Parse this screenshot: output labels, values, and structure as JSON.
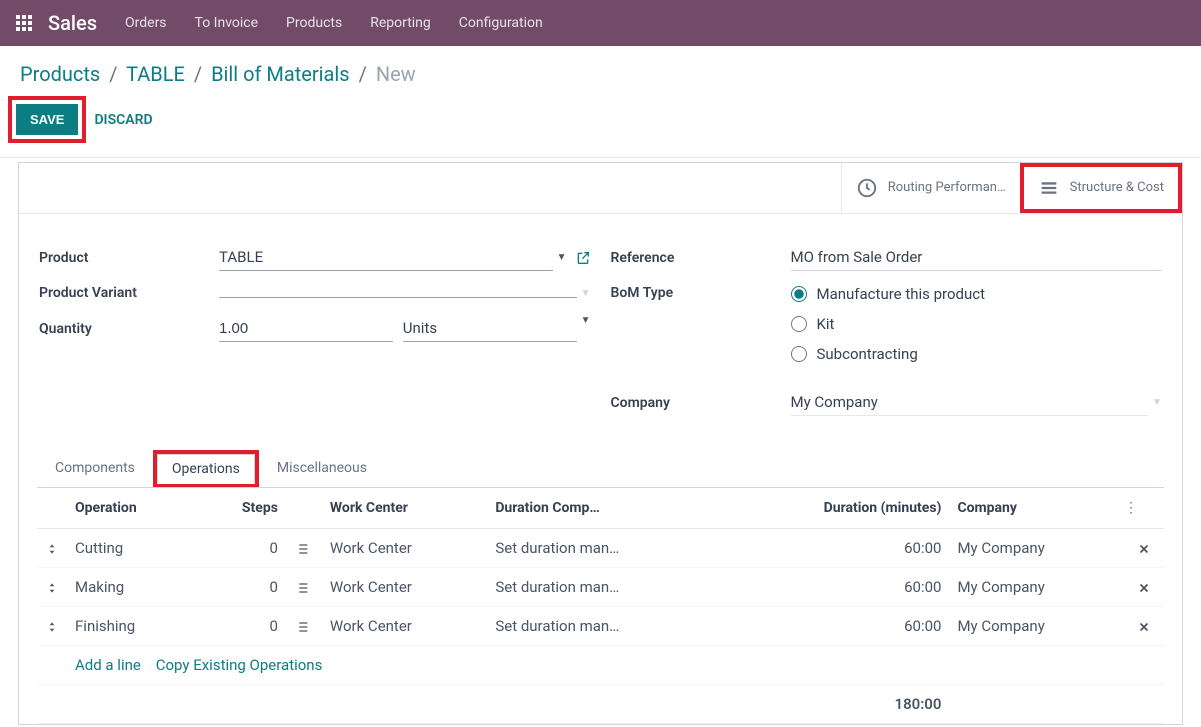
{
  "nav": {
    "brand": "Sales",
    "items": [
      "Orders",
      "To Invoice",
      "Products",
      "Reporting",
      "Configuration"
    ]
  },
  "breadcrumb": {
    "parts": [
      "Products",
      "TABLE",
      "Bill of Materials"
    ],
    "current": "New"
  },
  "actions": {
    "save": "SAVE",
    "discard": "DISCARD"
  },
  "stat_buttons": {
    "routing": "Routing Performan…",
    "structure": "Structure & Cost"
  },
  "form": {
    "product_label": "Product",
    "product_value": "TABLE",
    "variant_label": "Product Variant",
    "variant_value": "",
    "quantity_label": "Quantity",
    "quantity_value": "1.00",
    "quantity_unit": "Units",
    "reference_label": "Reference",
    "reference_value": "MO from Sale Order",
    "bom_type_label": "BoM Type",
    "bom_type_options": [
      "Manufacture this product",
      "Kit",
      "Subcontracting"
    ],
    "bom_type_selected": 0,
    "company_label": "Company",
    "company_value": "My Company"
  },
  "tabs": [
    "Components",
    "Operations",
    "Miscellaneous"
  ],
  "active_tab": 1,
  "grid": {
    "headers": {
      "operation": "Operation",
      "steps": "Steps",
      "work_center": "Work Center",
      "duration_comp": "Duration Comp…",
      "duration_min": "Duration (minutes)",
      "company": "Company"
    },
    "rows": [
      {
        "operation": "Cutting",
        "steps": "0",
        "work_center": "Work Center",
        "duration_comp": "Set duration man…",
        "duration_min": "60:00",
        "company": "My Company"
      },
      {
        "operation": "Making",
        "steps": "0",
        "work_center": "Work Center",
        "duration_comp": "Set duration man…",
        "duration_min": "60:00",
        "company": "My Company"
      },
      {
        "operation": "Finishing",
        "steps": "0",
        "work_center": "Work Center",
        "duration_comp": "Set duration man…",
        "duration_min": "60:00",
        "company": "My Company"
      }
    ],
    "add_line": "Add a line",
    "copy_ops": "Copy Existing Operations",
    "total_duration": "180:00"
  }
}
